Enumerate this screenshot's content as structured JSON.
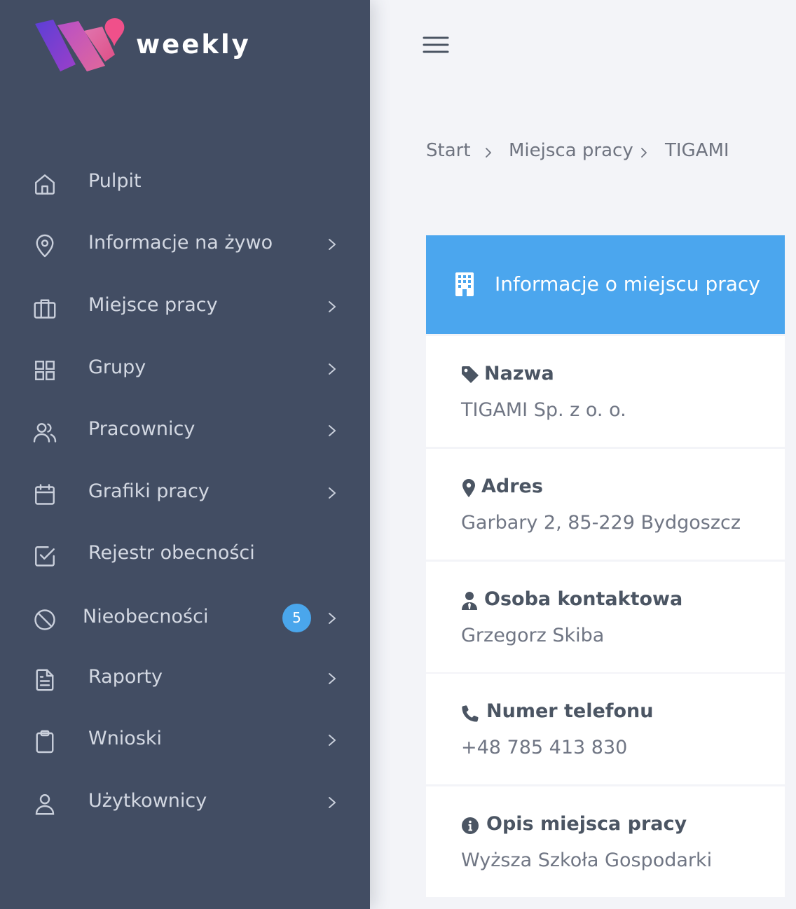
{
  "app": {
    "logo_text": "weekly"
  },
  "colors": {
    "sidebar_bg": "#424d63",
    "accent": "#4ba6ee",
    "badge": "#4aa6ec",
    "page_bg": "#f3f4f8"
  },
  "sidebar": {
    "items": [
      {
        "label": "Pulpit",
        "icon": "home-icon",
        "has_chevron": false
      },
      {
        "label": "Informacje na żywo",
        "icon": "map-pin-icon",
        "has_chevron": true
      },
      {
        "label": "Miejsce pracy",
        "icon": "briefcase-icon",
        "has_chevron": true
      },
      {
        "label": "Grupy",
        "icon": "grid-icon",
        "has_chevron": true
      },
      {
        "label": "Pracownicy",
        "icon": "users-icon",
        "has_chevron": true
      },
      {
        "label": "Grafiki pracy",
        "icon": "calendar-icon",
        "has_chevron": true
      },
      {
        "label": "Rejestr obecności",
        "icon": "check-square-icon",
        "has_chevron": false
      },
      {
        "label": "Nieobecności",
        "icon": "ban-icon",
        "has_chevron": true,
        "badge": "5"
      },
      {
        "label": "Raporty",
        "icon": "file-text-icon",
        "has_chevron": true
      },
      {
        "label": "Wnioski",
        "icon": "clipboard-icon",
        "has_chevron": true
      },
      {
        "label": "Użytkownicy",
        "icon": "user-icon",
        "has_chevron": true
      }
    ]
  },
  "breadcrumb": [
    "Start",
    "Miejsca pracy",
    "TIGAMI"
  ],
  "card": {
    "title": "Informacje o miejscu pracy",
    "title_icon": "building-icon",
    "fields": [
      {
        "label": "Nazwa",
        "value": "TIGAMI Sp. z o. o.",
        "icon": "tag-icon"
      },
      {
        "label": "Adres",
        "value": "Garbary 2, 85-229 Bydgoszcz",
        "icon": "map-marker-icon"
      },
      {
        "label": "Osoba kontaktowa",
        "value": "Grzegorz Skiba",
        "icon": "user-tie-icon"
      },
      {
        "label": "Numer telefonu",
        "value": "+48 785 413 830",
        "icon": "phone-icon"
      },
      {
        "label": "Opis miejsca pracy",
        "value": "Wyższa Szkoła Gospodarki",
        "icon": "info-circle-icon"
      }
    ]
  }
}
